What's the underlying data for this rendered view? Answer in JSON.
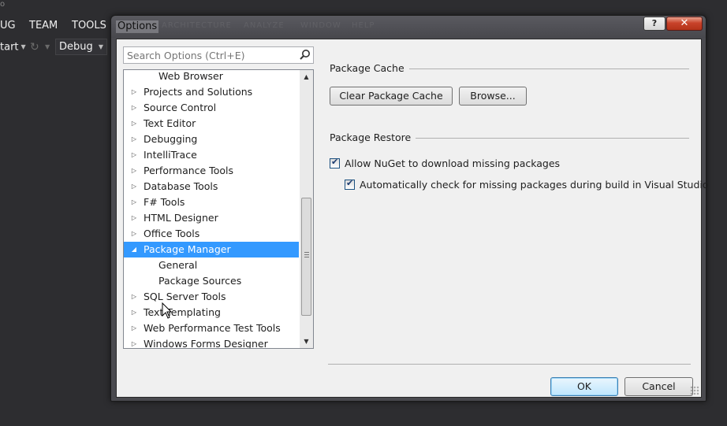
{
  "vs": {
    "menus": [
      "UG",
      "TEAM",
      "TOOLS"
    ],
    "start_label": "tart",
    "config_value": "Debug",
    "corner_text": "o"
  },
  "dialog": {
    "title": "Options",
    "help_label": "?",
    "close_label": "✕",
    "ghost_menus": [
      "ARCHITECTURE",
      "ANALYZE",
      "WINDOW",
      "HELP"
    ]
  },
  "search": {
    "placeholder": "Search Options (Ctrl+E)",
    "value": ""
  },
  "tree": [
    {
      "label": "Web Browser",
      "expander": "",
      "level": 1,
      "selected": false
    },
    {
      "label": "Projects and Solutions",
      "expander": "▷",
      "level": 0,
      "selected": false
    },
    {
      "label": "Source Control",
      "expander": "▷",
      "level": 0,
      "selected": false
    },
    {
      "label": "Text Editor",
      "expander": "▷",
      "level": 0,
      "selected": false
    },
    {
      "label": "Debugging",
      "expander": "▷",
      "level": 0,
      "selected": false
    },
    {
      "label": "IntelliTrace",
      "expander": "▷",
      "level": 0,
      "selected": false
    },
    {
      "label": "Performance Tools",
      "expander": "▷",
      "level": 0,
      "selected": false
    },
    {
      "label": "Database Tools",
      "expander": "▷",
      "level": 0,
      "selected": false
    },
    {
      "label": "F# Tools",
      "expander": "▷",
      "level": 0,
      "selected": false
    },
    {
      "label": "HTML Designer",
      "expander": "▷",
      "level": 0,
      "selected": false
    },
    {
      "label": "Office Tools",
      "expander": "▷",
      "level": 0,
      "selected": false
    },
    {
      "label": "Package Manager",
      "expander": "◢",
      "level": 0,
      "selected": true
    },
    {
      "label": "General",
      "expander": "",
      "level": 1,
      "selected": false
    },
    {
      "label": "Package Sources",
      "expander": "",
      "level": 1,
      "selected": false
    },
    {
      "label": "SQL Server Tools",
      "expander": "▷",
      "level": 0,
      "selected": false
    },
    {
      "label": "Text Templating",
      "expander": "▷",
      "level": 0,
      "selected": false
    },
    {
      "label": "Web Performance Test Tools",
      "expander": "▷",
      "level": 0,
      "selected": false
    },
    {
      "label": "Windows Forms Designer",
      "expander": "▷",
      "level": 0,
      "selected": false
    }
  ],
  "package_cache": {
    "header": "Package Cache",
    "clear_button": "Clear Package Cache",
    "browse_button": "Browse..."
  },
  "package_restore": {
    "header": "Package Restore",
    "allow_download": {
      "label": "Allow NuGet to download missing packages",
      "checked": true
    },
    "auto_check": {
      "label": "Automatically check for missing packages during build in Visual Studio",
      "checked": true
    }
  },
  "footer": {
    "ok_label": "OK",
    "cancel_label": "Cancel"
  },
  "colors": {
    "selection": "#3399ff",
    "vs_background": "#2d2d30",
    "close_button": "#c8432b"
  }
}
